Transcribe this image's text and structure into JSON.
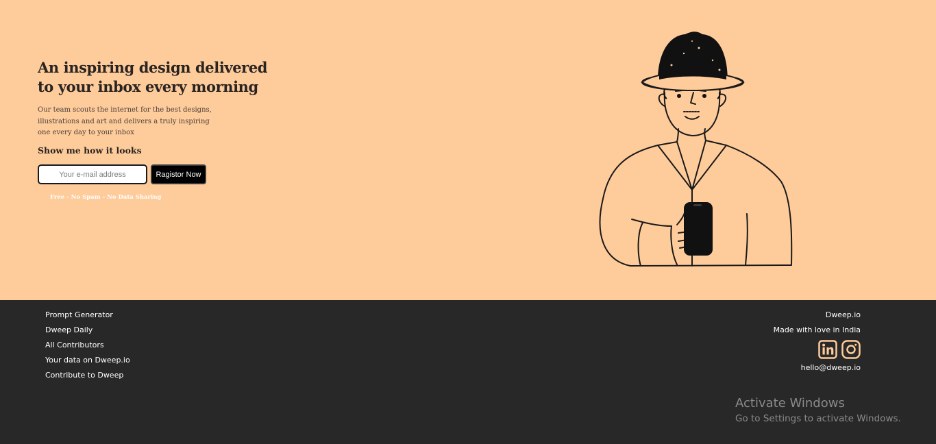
{
  "hero": {
    "title": "An inspiring design delivered to your inbox every morning",
    "description": "Our team scouts the internet for the best designs, illustrations and art and delivers a truly inspiring one every day to your inbox",
    "subheading": "Show me how it looks",
    "email_placeholder": "Your e-mail address",
    "register_label": "Ragistor Now",
    "note": "Free - No Spam - No Data Sharing",
    "illustration_icon": "man-with-hat-holding-phone-illustration"
  },
  "footer": {
    "links": [
      "Prompt Generator",
      "Dweep Daily",
      "All Contributors",
      "Your data on Dweep.io",
      "Contribute to Dweep"
    ],
    "brand": "Dweep.io",
    "tagline": "Made with love in India",
    "social": [
      "linkedin-icon",
      "instagram-icon"
    ],
    "email": "hello@dweep.io"
  },
  "watermark": {
    "title": "Activate Windows",
    "subtitle": "Go to Settings to activate Windows."
  },
  "colors": {
    "hero_bg": "#fecb9b",
    "footer_bg": "#282828",
    "social_accent": "#fecb9b"
  }
}
